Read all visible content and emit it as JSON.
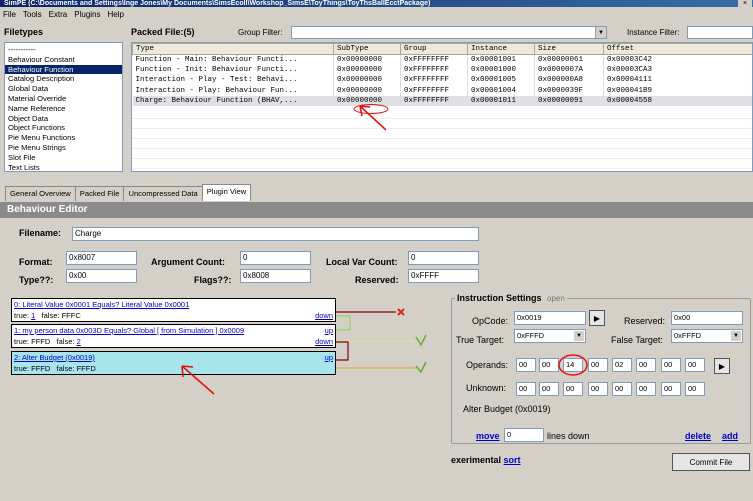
{
  "window": {
    "title": "SimPE (C:\\Documents and Settings\\Inge Jones\\My Documents\\SimsEcoll\\Workshop_SimsE\\ToyThings\\ToyThsBallEcctPackage)"
  },
  "menu": [
    "File",
    "Tools",
    "Extra",
    "Plugins",
    "Help"
  ],
  "filetypes": {
    "title": "Filetypes",
    "items": [
      "-----------",
      "Behaviour Constant",
      "Behaviour Function",
      "Catalog Description",
      "Global Data",
      "Material Override",
      "Name Reference",
      "Object Data",
      "Object Functions",
      "Pie Menu Functions",
      "Pie Menu Strings",
      "Slot File",
      "Text Lists"
    ],
    "selected_index": 2
  },
  "packed": {
    "title": "Packed File:(5)",
    "group_filter_label": "Group Filter:",
    "instance_filter_label": "Instance Filter:",
    "columns": [
      "Type",
      "SubType",
      "Group",
      "Instance",
      "Size",
      "Offset"
    ],
    "rows": [
      [
        "Function - Main: Behaviour Functi...",
        "0x00000000",
        "0xFFFFFFFF",
        "0x00001001",
        "0x00000061",
        "0x00003C42"
      ],
      [
        "Function - Init: Behaviour Functi...",
        "0x00000000",
        "0xFFFFFFFF",
        "0x00001000",
        "0x0000007A",
        "0x00003CA3"
      ],
      [
        "Interaction - Play - Test: Behavi...",
        "0x00000000",
        "0xFFFFFFFF",
        "0x00001005",
        "0x000000A8",
        "0x00004111"
      ],
      [
        "Interaction - Play: Behaviour Fun...",
        "0x00000000",
        "0xFFFFFFFF",
        "0x00001004",
        "0x0000039F",
        "0x000041B9"
      ],
      [
        "Charge: Behaviour Function (BHAV,...",
        "0x00000000",
        "0xFFFFFFFF",
        "0x00001011",
        "0x00000091",
        "0x00004558"
      ]
    ],
    "selected_row": 4
  },
  "tabs": [
    "General Overview",
    "Packed File",
    "Uncompressed Data",
    "Plugin View"
  ],
  "active_tab": 3,
  "editor": {
    "header": "Behaviour Editor",
    "filename_label": "Filename:",
    "filename": "Charge",
    "format_label": "Format:",
    "format": "0x8007",
    "type_label": "Type??:",
    "type": "0x00",
    "arg_label": "Argument Count:",
    "arg": "0",
    "flags_label": "Flags??:",
    "flags": "0x8008",
    "localvar_label": "Local Var Count:",
    "localvar": "0",
    "reserved_label": "Reserved:",
    "reserved": "0xFFFF"
  },
  "instructions": [
    {
      "title": "0: Literal Value 0x0001 Equals? Literal Value 0x0001",
      "true_label": "true:",
      "true_val": "1",
      "false_label": "false:",
      "false_val": "FFFC",
      "links": [
        "down"
      ]
    },
    {
      "title": "1: my person data 0x003D Equals? Global [ from Simulation ] 0x0009",
      "true_label": "true:",
      "true_val": "FFFD",
      "false_label": "false:",
      "false_val": "2",
      "links": [
        "up",
        "down"
      ]
    },
    {
      "title": "2: Alter Budget (0x0019)",
      "true_label": "true:",
      "true_val": "FFFD",
      "false_label": "false:",
      "false_val": "FFFD",
      "links": [
        "up"
      ]
    }
  ],
  "settings": {
    "title": "Instruction Settings",
    "open_label": "open",
    "opcode_label": "OpCode:",
    "opcode": "0x0019",
    "reserved_label": "Reserved:",
    "reserved": "0x00",
    "true_target_label": "True Target:",
    "true_target": "0xFFFD",
    "false_target_label": "False Target:",
    "false_target": "0xFFFD",
    "operands_label": "Operands:",
    "operands": [
      "00",
      "00",
      "14",
      "00",
      "02",
      "00",
      "00",
      "00"
    ],
    "unknown_label": "Unknown:",
    "unknown": [
      "00",
      "00",
      "00",
      "00",
      "00",
      "00",
      "00",
      "00"
    ],
    "description": "Alter Budget (0x0019)",
    "move_label": "move",
    "move_value": "0",
    "lines_down_label": "lines down",
    "delete_label": "delete",
    "add_label": "add"
  },
  "experimental": {
    "label": "exerimental",
    "sort_label": "sort"
  },
  "commit_label": "Commit File"
}
